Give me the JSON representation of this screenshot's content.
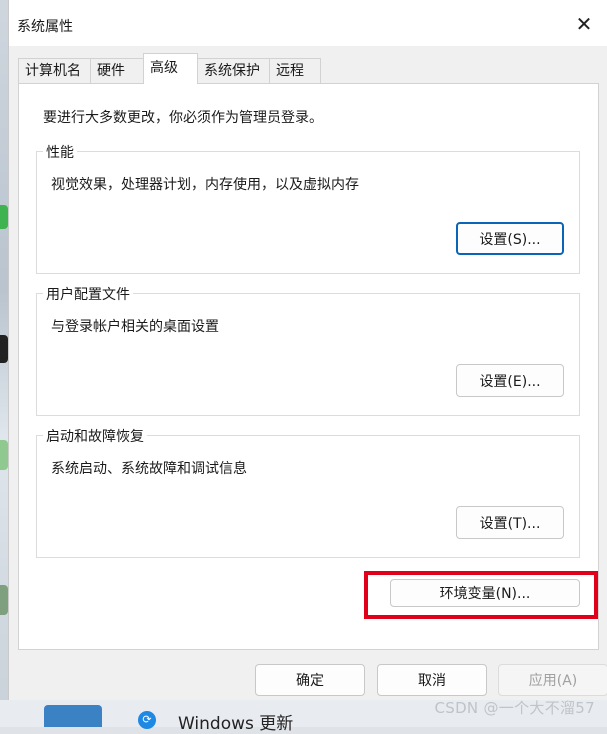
{
  "dialog": {
    "title": "系统属性",
    "close_glyph": "✕"
  },
  "tabs": [
    {
      "label": "计算机名"
    },
    {
      "label": "硬件"
    },
    {
      "label": "高级"
    },
    {
      "label": "系统保护"
    },
    {
      "label": "远程"
    }
  ],
  "active_tab": "高级",
  "notice": "要进行大多数更改，你必须作为管理员登录。",
  "groups": {
    "performance": {
      "title": "性能",
      "description": "视觉效果，处理器计划，内存使用，以及虚拟内存",
      "button": "设置(S)..."
    },
    "user_profiles": {
      "title": "用户配置文件",
      "description": "与登录帐户相关的桌面设置",
      "button": "设置(E)..."
    },
    "startup_recovery": {
      "title": "启动和故障恢复",
      "description": "系统启动、系统故障和调试信息",
      "button": "设置(T)..."
    }
  },
  "env_button": "环境变量(N)...",
  "footer": {
    "ok": "确定",
    "cancel": "取消",
    "apply": "应用(A)"
  },
  "taskbar": {
    "update_text": "Windows 更新"
  },
  "watermark": "CSDN @一个大不溜57",
  "colors": {
    "highlight": "#e1001a",
    "focus": "#0a64b7"
  },
  "icons": {
    "close": "close-icon",
    "update": "windows-update-icon"
  }
}
